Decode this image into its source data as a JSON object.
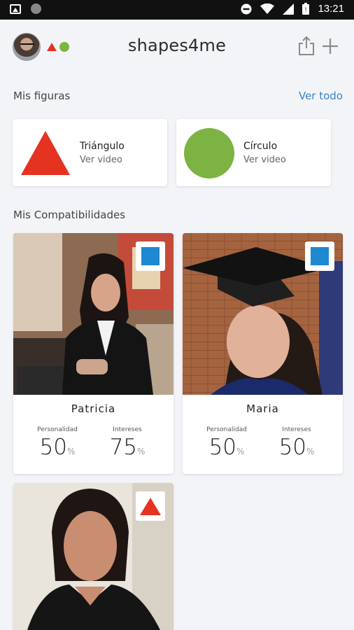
{
  "status_bar": {
    "time": "13:21"
  },
  "header": {
    "logo": "shapes4me"
  },
  "figures_section": {
    "title": "Mis figuras",
    "see_all": "Ver todo"
  },
  "figures": [
    {
      "name": "Triángulo",
      "action": "Ver video",
      "shape": "triangle",
      "color": "#e53321"
    },
    {
      "name": "Círculo",
      "action": "Ver video",
      "shape": "circle",
      "color": "#7cb342"
    }
  ],
  "matches_section": {
    "title": "Mis Compatibilidades"
  },
  "matches": [
    {
      "name": "Patricia",
      "badge": "square",
      "personality_label": "Personalidad",
      "personality": "50",
      "interests_label": "Intereses",
      "interests": "75",
      "unit": "%"
    },
    {
      "name": "Maria",
      "badge": "square",
      "personality_label": "Personalidad",
      "personality": "50",
      "interests_label": "Intereses",
      "interests": "50",
      "unit": "%"
    },
    {
      "name": "",
      "badge": "triangle"
    }
  ],
  "colors": {
    "red": "#e53321",
    "green": "#7cb342",
    "blue": "#1e88d0",
    "link": "#3b84c4"
  }
}
